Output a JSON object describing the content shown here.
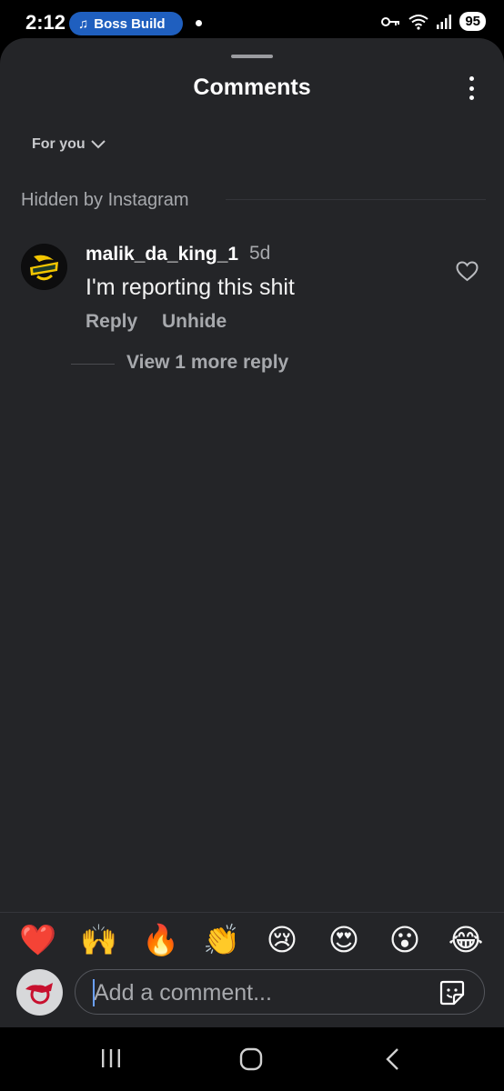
{
  "status_bar": {
    "time": "2:12",
    "media_label": "Boss Build",
    "battery": "95"
  },
  "sheet": {
    "title": "Comments",
    "sort_label": "For you",
    "hidden_section_label": "Hidden by Instagram"
  },
  "comment": {
    "username": "malik_da_king_1",
    "age": "5d",
    "text": "I'm reporting this shit",
    "reply_label": "Reply",
    "unhide_label": "Unhide",
    "view_replies_label": "View 1 more reply"
  },
  "emoji_bar": {
    "items": [
      "❤️",
      "🙌",
      "🔥",
      "👏",
      "😢",
      "😍",
      "😮",
      "😂"
    ]
  },
  "composer": {
    "placeholder": "Add a comment..."
  },
  "colors": {
    "sheet_bg": "#242528",
    "accent_pill": "#1f5fbf",
    "muted_text": "#a7a9ad"
  }
}
